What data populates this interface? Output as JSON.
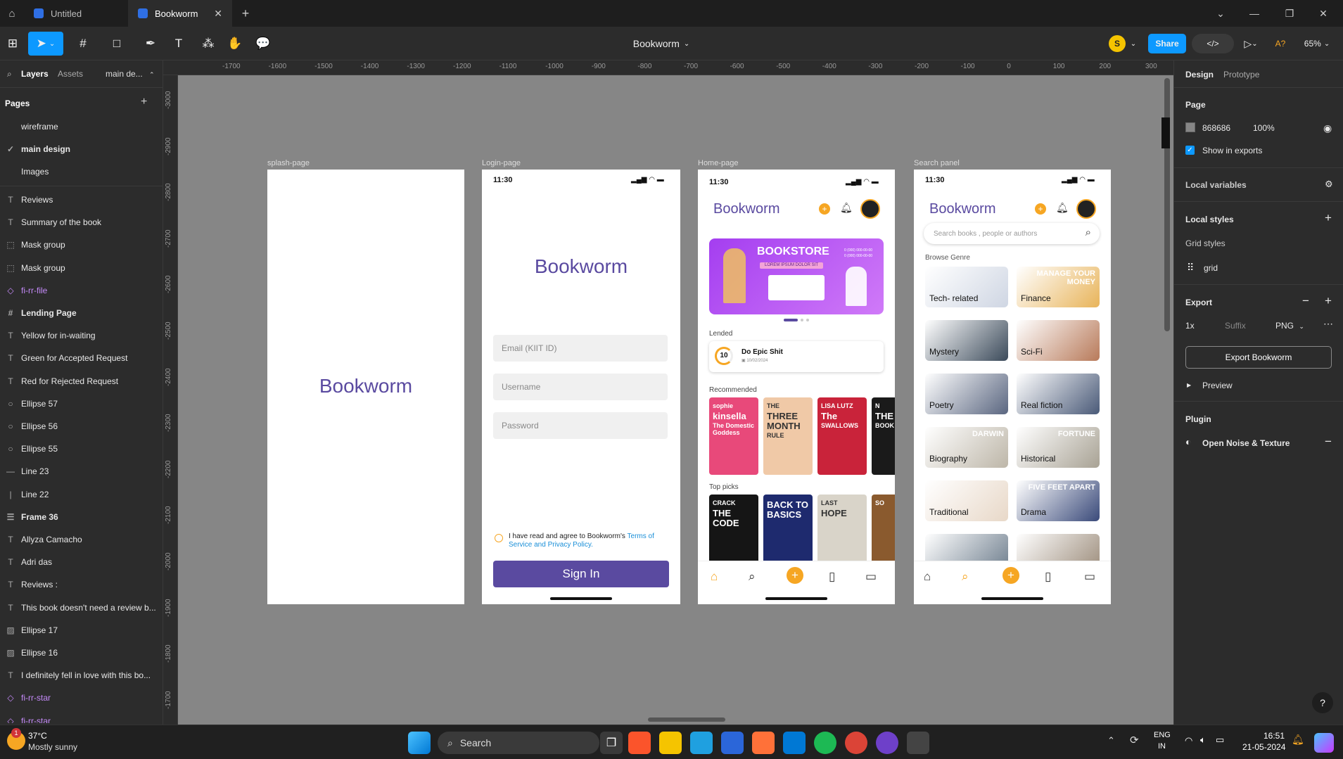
{
  "tabs": [
    {
      "label": "Untitled"
    },
    {
      "label": "Bookworm"
    }
  ],
  "toolbar": {
    "file_title": "Bookworm",
    "avatar_initial": "S",
    "share_label": "Share",
    "zoom": "65%",
    "a_label": "A?"
  },
  "left": {
    "tab_layers": "Layers",
    "tab_assets": "Assets",
    "page_select": "main de...",
    "pages_heading": "Pages",
    "pages": [
      "wireframe",
      "main design",
      "Images"
    ],
    "layers": [
      {
        "icon": "text-icon",
        "label": "Reviews",
        "style": ""
      },
      {
        "icon": "text-icon",
        "label": "Summary of the book",
        "style": ""
      },
      {
        "icon": "mask-icon",
        "label": "Mask group",
        "style": ""
      },
      {
        "icon": "mask-icon",
        "label": "Mask group",
        "style": ""
      },
      {
        "icon": "component-icon",
        "label": "fi-rr-file",
        "style": "purple"
      },
      {
        "icon": "frame-icon",
        "label": "Lending Page",
        "style": "bold"
      },
      {
        "icon": "text-icon",
        "label": "Yellow for in-waiting",
        "style": ""
      },
      {
        "icon": "text-icon",
        "label": "Green for Accepted Request",
        "style": ""
      },
      {
        "icon": "text-icon",
        "label": "Red for Rejected Request",
        "style": ""
      },
      {
        "icon": "ellipse-icon",
        "label": "Ellipse 57",
        "style": ""
      },
      {
        "icon": "ellipse-icon",
        "label": "Ellipse 56",
        "style": ""
      },
      {
        "icon": "ellipse-icon",
        "label": "Ellipse 55",
        "style": ""
      },
      {
        "icon": "line-icon",
        "label": "Line 23",
        "style": ""
      },
      {
        "icon": "vline-icon",
        "label": "Line 22",
        "style": ""
      },
      {
        "icon": "autolayout-icon",
        "label": "Frame 36",
        "style": "bold"
      },
      {
        "icon": "text-icon",
        "label": "Allyza Camacho",
        "style": ""
      },
      {
        "icon": "text-icon",
        "label": "Adri das",
        "style": ""
      },
      {
        "icon": "text-icon",
        "label": "Reviews :",
        "style": ""
      },
      {
        "icon": "text-icon",
        "label": "This book doesn't need a review b...",
        "style": ""
      },
      {
        "icon": "image-icon",
        "label": "Ellipse 17",
        "style": ""
      },
      {
        "icon": "image-icon",
        "label": "Ellipse 16",
        "style": ""
      },
      {
        "icon": "text-icon",
        "label": "I definitely fell in love with this bo...",
        "style": ""
      },
      {
        "icon": "component-icon",
        "label": "fi-rr-star",
        "style": "purple"
      },
      {
        "icon": "component-icon",
        "label": "fi-rr-star",
        "style": "purple"
      }
    ]
  },
  "ruler": {
    "top": [
      "-1700",
      "-1600",
      "-1500",
      "-1400",
      "-1300",
      "-1200",
      "-1100",
      "-1000",
      "-900",
      "-800",
      "-700",
      "-600",
      "-500",
      "-400",
      "-300",
      "-200",
      "-100",
      "0",
      "100",
      "200",
      "300"
    ],
    "left": [
      "-3000",
      "-2900",
      "-2800",
      "-2700",
      "-2600",
      "-2500",
      "-2400",
      "-2300",
      "-2200",
      "-2100",
      "-2000",
      "-1900",
      "-1800",
      "-1700"
    ]
  },
  "frames": {
    "splash": {
      "label": "splash-page",
      "brand": "Bookworm"
    },
    "login": {
      "label": "Login-page",
      "time": "11:30",
      "brand": "Bookworm",
      "email_ph": "Email (KIIT ID)",
      "username_ph": "Username",
      "password_ph": "Password",
      "agree_text": "I have read and agree to Bookworm's",
      "agree_link": "Terms of Service and Privacy Policy.",
      "signin": "Sign In"
    },
    "home": {
      "label": "Home-page",
      "time": "11:30",
      "brand": "Bookworm",
      "banner_title": "BOOKSTORE",
      "banner_sub": "LOREM IPSUM DOLOR SIT",
      "banner_phone1": "0 (000) 000-00-00",
      "banner_phone2": "0 (000) 000-00-00",
      "lended_heading": "Lended",
      "lended_days": "10",
      "lended_title": "Do Epic Shit",
      "lended_date": "10/02/2024",
      "recommended_heading": "Recommended",
      "rec_books": [
        {
          "line1": "sophie",
          "line2": "kinsella",
          "line3": "The Domestic Goddess",
          "color": "#e8497a"
        },
        {
          "line1": "THE",
          "line2": "THREE MONTH",
          "line3": "RULE",
          "color": "#f0c9a7"
        },
        {
          "line1": "LISA LUTZ",
          "line2": "The",
          "line3": "SWALLOWS",
          "color": "#c9233a"
        },
        {
          "line1": "N",
          "line2": "THE",
          "line3": "BOOK TI",
          "color": "#1a1a1a"
        }
      ],
      "top_heading": "Top picks",
      "top_books": [
        {
          "line1": "CRACK",
          "line2": "THE CODE",
          "color": "#151515"
        },
        {
          "line1": "",
          "line2": "BACK TO BASICS",
          "color": "#1e2a6e"
        },
        {
          "line1": "LAST",
          "line2": "HOPE",
          "color": "#d9d4c9"
        },
        {
          "line1": "SO",
          "line2": "",
          "color": "#8a5a2e"
        }
      ]
    },
    "search": {
      "label": "Search panel",
      "time": "11:30",
      "brand": "Bookworm",
      "search_ph": "Search books , people or authors",
      "browse_heading": "Browse Genre",
      "genres": [
        {
          "label": "Tech- related",
          "color": "#cfd6e3"
        },
        {
          "label": "Finance",
          "color": "#e8b45a",
          "overlay": "MANAGE YOUR MONEY"
        },
        {
          "label": "Mystery",
          "color": "#3b4a5a"
        },
        {
          "label": "Sci-Fi",
          "color": "#b87a5a"
        },
        {
          "label": "Poetry",
          "color": "#5a6680"
        },
        {
          "label": "Real fiction",
          "color": "#4a5a78"
        },
        {
          "label": "Biography",
          "color": "#bdb6a8",
          "overlay": "DARWIN"
        },
        {
          "label": "Historical",
          "color": "#a8a294",
          "overlay": "FORTUNE"
        },
        {
          "label": "Traditional",
          "color": "#e8d8c8"
        },
        {
          "label": "Drama",
          "color": "#3a4a7a",
          "overlay": "FIVE FEET APART"
        },
        {
          "label": "",
          "color": "#6a7a8a"
        },
        {
          "label": "",
          "color": "#9a8a78"
        }
      ]
    }
  },
  "right": {
    "tab_design": "Design",
    "tab_prototype": "Prototype",
    "page_heading": "Page",
    "page_color": "868686",
    "page_opacity": "100%",
    "show_exports": "Show in exports",
    "local_variables": "Local variables",
    "local_styles": "Local styles",
    "grid_styles": "Grid styles",
    "grid_name": "grid",
    "export_heading": "Export",
    "export_scale": "1x",
    "export_suffix": "Suffix",
    "export_format": "PNG",
    "export_button": "Export Bookworm",
    "preview": "Preview",
    "plugin_heading": "Plugin",
    "plugin_name": "Open Noise & Texture",
    "help": "?"
  },
  "taskbar": {
    "weather_temp": "37°C",
    "weather_desc": "Mostly sunny",
    "weather_badge": "1",
    "search_label": "Search",
    "lang1": "ENG",
    "lang2": "IN",
    "time": "16:51",
    "date": "21-05-2024"
  },
  "colors": {
    "brand": "#5a4aa0",
    "share": "#0d99ff",
    "accent": "#f6a623",
    "canvas": "#868686"
  }
}
